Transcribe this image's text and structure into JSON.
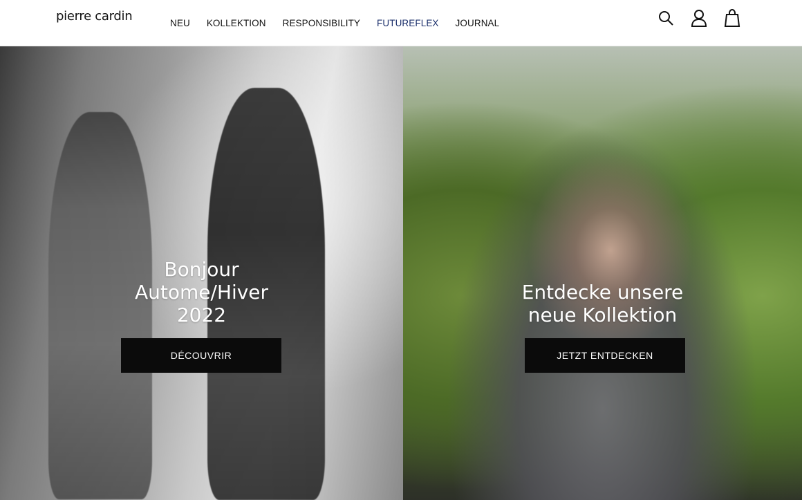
{
  "header": {
    "logo": "pierre cardin",
    "nav": [
      {
        "label": "NEU"
      },
      {
        "label": "KOLLEKTION"
      },
      {
        "label": "RESPONSIBILITY"
      },
      {
        "label": "FUTUREFLEX"
      },
      {
        "label": "JOURNAL"
      }
    ],
    "accent_nav_color": "#1b2f6b",
    "icons": [
      "search-icon",
      "user-icon",
      "bag-icon"
    ]
  },
  "hero": {
    "left": {
      "lines": [
        "Bonjour",
        "Autome/Hiver",
        "2022"
      ],
      "cta": "DÉCOUVRIR"
    },
    "right": {
      "lines": [
        "Entdecke unsere",
        "neue Kollektion"
      ],
      "cta": "JETZT ENTDECKEN"
    }
  },
  "colors": {
    "button_bg": "#0b0b0b",
    "text_on_image": "#ffffff"
  }
}
